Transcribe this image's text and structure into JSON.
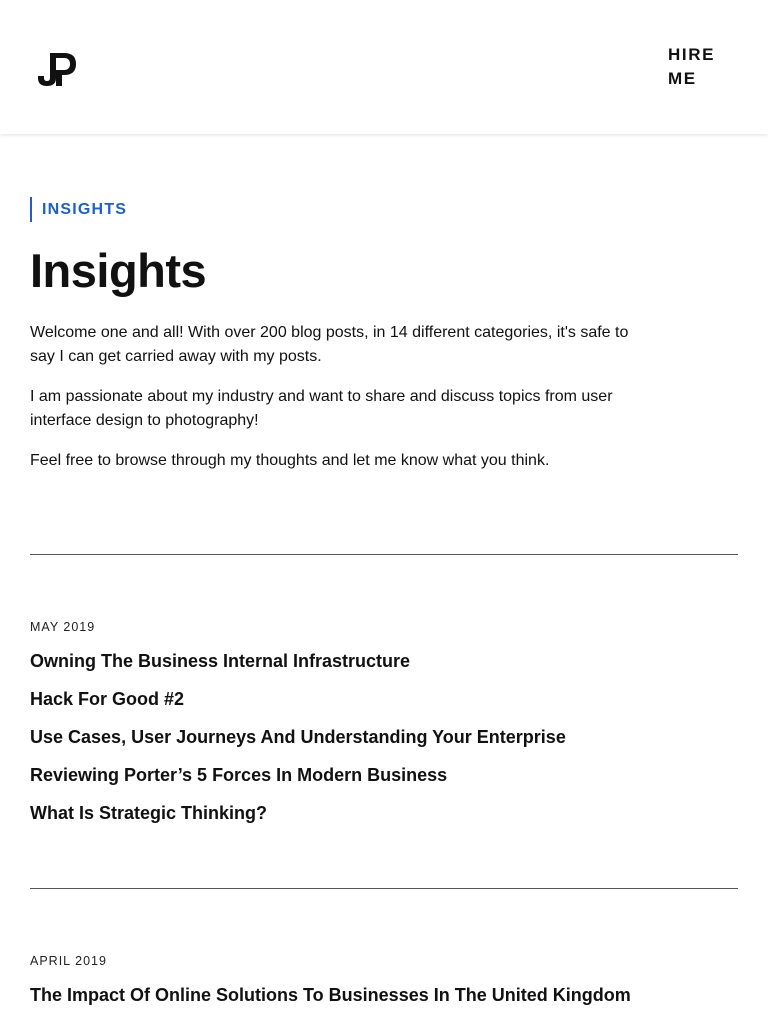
{
  "header": {
    "logo_text": "JP",
    "hire_label": "HIRE\nME"
  },
  "page": {
    "eyebrow": "INSIGHTS",
    "title": "Insights",
    "intro": [
      "Welcome one and all! With over 200 blog posts, in 14 different categories, it's safe to say I can get carried away with my posts.",
      "I am passionate about my industry and want to share and discuss topics from user interface design to photography!",
      "Feel free to browse through my thoughts and let me know what you think."
    ]
  },
  "archive": [
    {
      "month": "MAY 2019",
      "posts": [
        "Owning The Business Internal Infrastructure",
        "Hack For Good #2",
        "Use Cases, User Journeys And Understanding Your Enterprise",
        "Reviewing Porter’s 5 Forces In Modern Business",
        "What Is Strategic Thinking?"
      ]
    },
    {
      "month": "APRIL 2019",
      "posts": [
        "The Impact Of Online Solutions To Businesses In The United Kingdom"
      ]
    }
  ],
  "colors": {
    "accent": "#1a5fd6",
    "text": "#111111",
    "divider": "#555555"
  }
}
